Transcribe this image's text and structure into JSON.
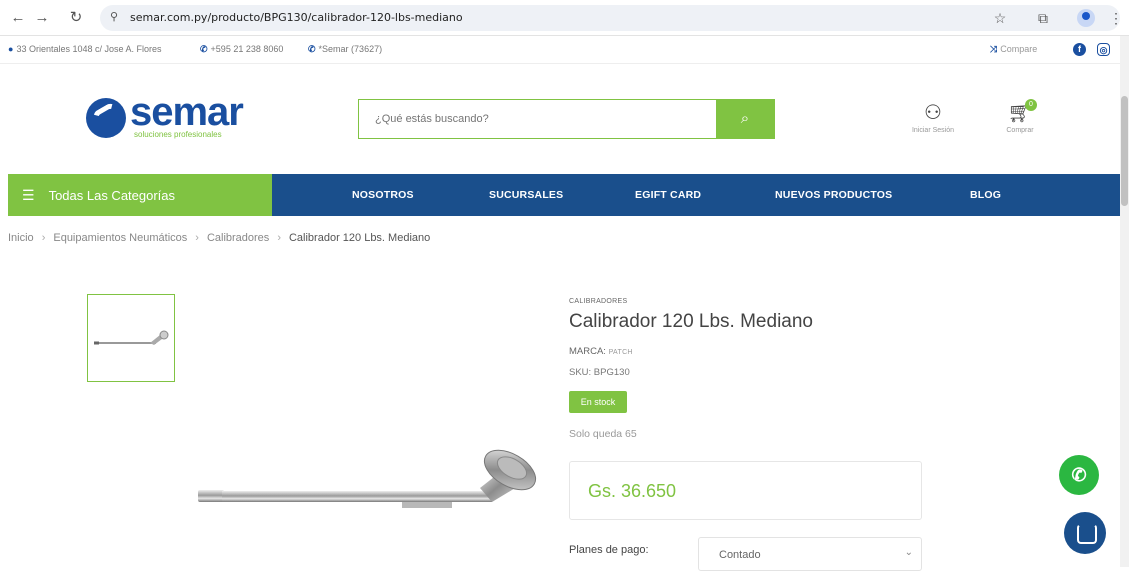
{
  "browser": {
    "url": "semar.com.py/producto/BPG130/calibrador-120-lbs-mediano",
    "icons": [
      "back-icon",
      "forward-icon",
      "reload-icon",
      "site-info-icon",
      "star-icon",
      "extensions-icon",
      "profile-avatar",
      "menu-icon"
    ]
  },
  "infobar": {
    "address": "33 Orientales 1048 c/ Jose A. Flores",
    "phone": "+595 21 238 8060",
    "short_phone": "*Semar (73627)",
    "compare": "Compare"
  },
  "header": {
    "logo_word": "semar",
    "logo_tagline": "soluciones profesionales",
    "search_placeholder": "¿Qué estás buscando?",
    "login_label": "Iniciar Sesión",
    "cart_label": "Comprar",
    "cart_count": "0"
  },
  "nav": {
    "categories_label": "Todas Las Categorías",
    "links": [
      "NOSOTROS",
      "SUCURSALES",
      "EGIFT CARD",
      "NUEVOS PRODUCTOS",
      "BLOG"
    ]
  },
  "breadcrumb": {
    "items": [
      "Inicio",
      "Equipamientos Neumáticos",
      "Calibradores",
      "Calibrador 120 Lbs. Mediano"
    ]
  },
  "product": {
    "category": "CALIBRADORES",
    "title": "Calibrador 120 Lbs. Mediano",
    "brand_label": "MARCA:",
    "brand": "PATCH",
    "sku": "SKU: BPG130",
    "stock_badge": "En stock",
    "stock_left": "Solo queda 65",
    "price": "Gs. 36.650",
    "payment_label": "Planes de pago:",
    "payment_value": "Contado"
  },
  "colors": {
    "brand_blue": "#1a4f8c",
    "brand_green": "#80c342",
    "whatsapp": "#2bb741"
  }
}
